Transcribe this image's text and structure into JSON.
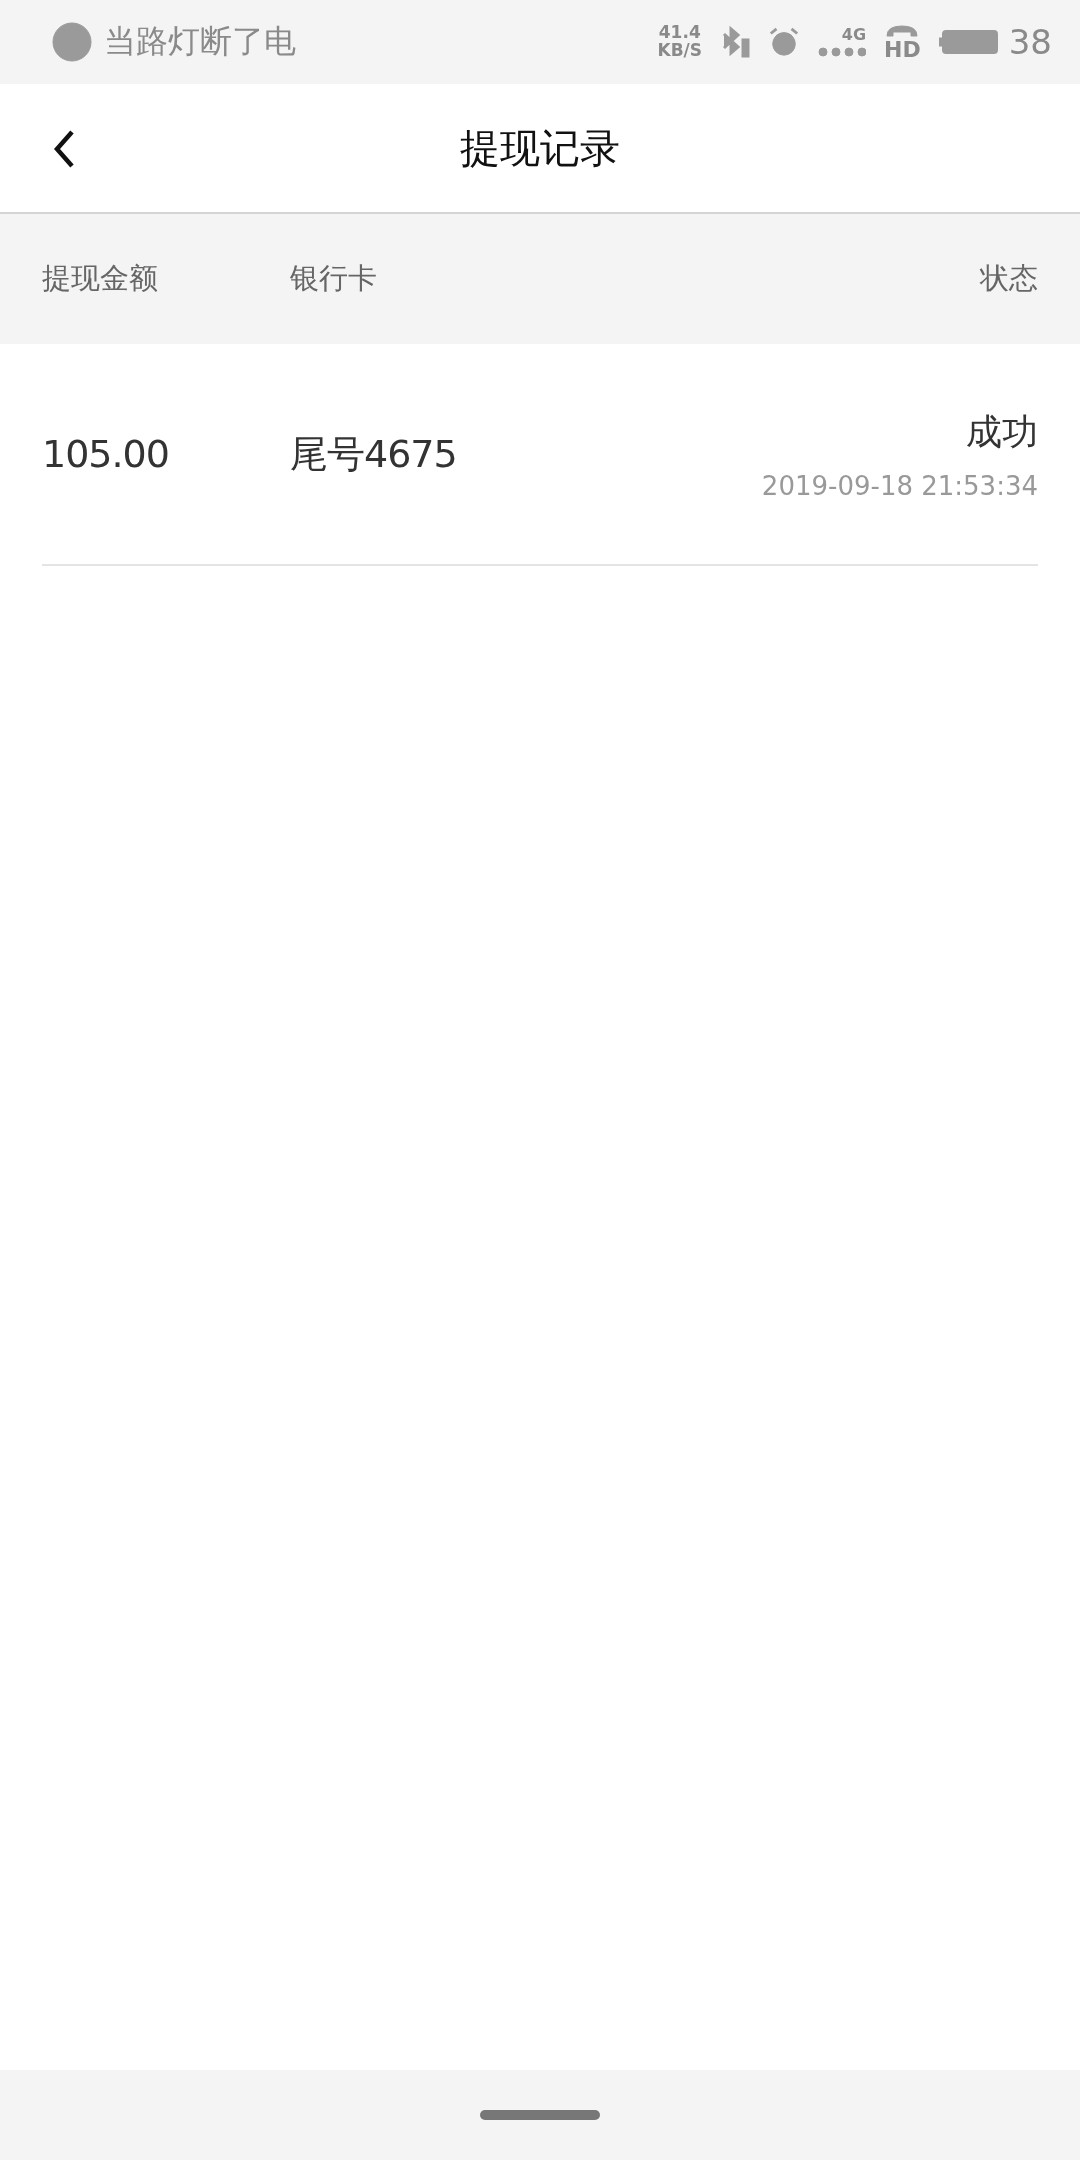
{
  "status_bar": {
    "song": "当路灯断了电",
    "speed_value": "41.4",
    "speed_unit": "KB/S",
    "network": "4G",
    "hd": "HD",
    "battery": "38"
  },
  "header": {
    "title": "提现记录"
  },
  "columns": [
    "提现金额",
    "银行卡",
    "状态"
  ],
  "records": [
    {
      "amount": "105.00",
      "card": "尾号4675",
      "status": "成功",
      "time": "2019-09-18 21:53:34"
    }
  ]
}
